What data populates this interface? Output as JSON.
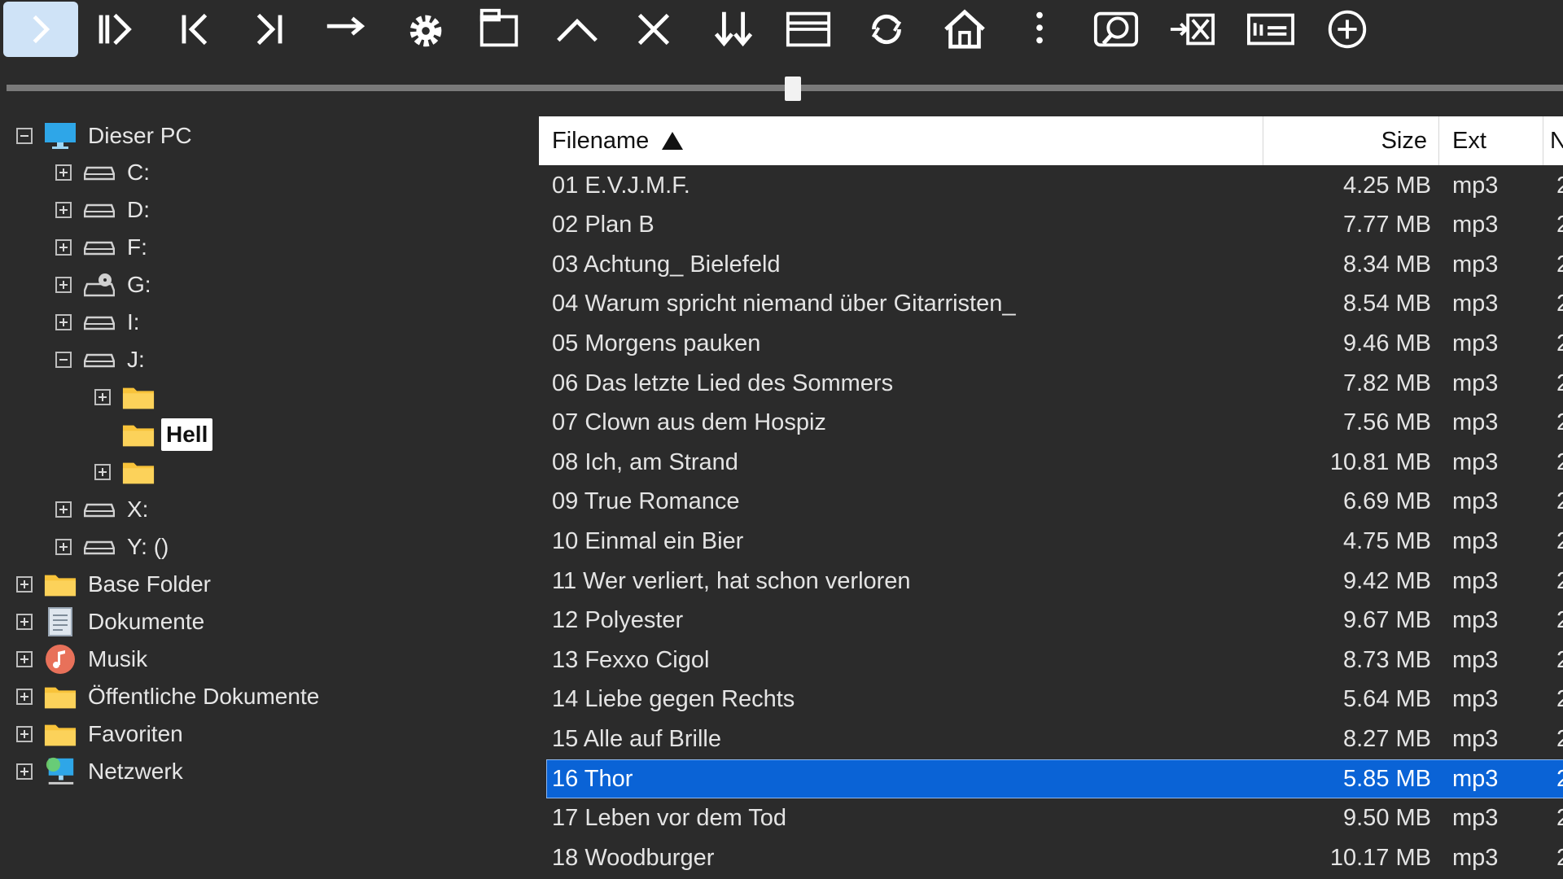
{
  "tree": {
    "root": {
      "label": "Dieser PC"
    },
    "drives": [
      {
        "label": "C:",
        "expanded": false
      },
      {
        "label": "D:",
        "expanded": false
      },
      {
        "label": "F:",
        "expanded": false
      },
      {
        "label": "G:",
        "expanded": false
      },
      {
        "label": "I:",
        "expanded": false
      },
      {
        "label": "J:",
        "expanded": true
      },
      {
        "label": "X:",
        "expanded": false
      },
      {
        "label": "Y: ()",
        "expanded": false
      }
    ],
    "j_children": [
      {
        "label": "",
        "has_children": true
      },
      {
        "label": "Hell",
        "has_children": false
      },
      {
        "label": "",
        "has_children": true
      }
    ],
    "special": [
      {
        "label": "Base Folder",
        "icon": "folder-icon"
      },
      {
        "label": "Dokumente",
        "icon": "document-icon"
      },
      {
        "label": "Musik",
        "icon": "music-icon"
      },
      {
        "label": "Öffentliche Dokumente",
        "icon": "folder-icon"
      },
      {
        "label": "Favoriten",
        "icon": "folder-icon"
      },
      {
        "label": "Netzwerk",
        "icon": "network-icon"
      }
    ]
  },
  "list": {
    "columns": {
      "name": "Filename",
      "size": "Size",
      "ext": "Ext",
      "more": "N"
    },
    "rows": [
      {
        "name": "01 E.V.J.M.F.",
        "size": "4.25 MB",
        "ext": "mp3",
        "more": "2"
      },
      {
        "name": "02 Plan B",
        "size": "7.77 MB",
        "ext": "mp3",
        "more": "2"
      },
      {
        "name": "03 Achtung_ Bielefeld",
        "size": "8.34 MB",
        "ext": "mp3",
        "more": "2"
      },
      {
        "name": "04 Warum spricht niemand über Gitarristen_",
        "size": "8.54 MB",
        "ext": "mp3",
        "more": "2"
      },
      {
        "name": "05 Morgens pauken",
        "size": "9.46 MB",
        "ext": "mp3",
        "more": "2"
      },
      {
        "name": "06 Das letzte Lied des Sommers",
        "size": "7.82 MB",
        "ext": "mp3",
        "more": "2"
      },
      {
        "name": "07 Clown aus dem Hospiz",
        "size": "7.56 MB",
        "ext": "mp3",
        "more": "2"
      },
      {
        "name": "08 Ich, am Strand",
        "size": "10.81 MB",
        "ext": "mp3",
        "more": "2"
      },
      {
        "name": "09 True Romance",
        "size": "6.69 MB",
        "ext": "mp3",
        "more": "2"
      },
      {
        "name": "10 Einmal ein Bier",
        "size": "4.75 MB",
        "ext": "mp3",
        "more": "2"
      },
      {
        "name": "11 Wer verliert, hat schon verloren",
        "size": "9.42 MB",
        "ext": "mp3",
        "more": "2"
      },
      {
        "name": "12 Polyester",
        "size": "9.67 MB",
        "ext": "mp3",
        "more": "2"
      },
      {
        "name": "13 Fexxo Cigol",
        "size": "8.73 MB",
        "ext": "mp3",
        "more": "2"
      },
      {
        "name": "14 Liebe gegen Rechts",
        "size": "5.64 MB",
        "ext": "mp3",
        "more": "2"
      },
      {
        "name": "15 Alle auf Brille",
        "size": "8.27 MB",
        "ext": "mp3",
        "more": "2"
      },
      {
        "name": "16 Thor",
        "size": "5.85 MB",
        "ext": "mp3",
        "more": "2",
        "selected": true
      },
      {
        "name": "17 Leben vor dem Tod",
        "size": "9.50 MB",
        "ext": "mp3",
        "more": "2"
      },
      {
        "name": "18 Woodburger",
        "size": "10.17 MB",
        "ext": "mp3",
        "more": "2"
      }
    ]
  },
  "toolbar": {
    "icons": [
      "play-next-icon",
      "play-pause-icon",
      "skip-back-icon",
      "skip-forward-icon",
      "arrow-right-icon",
      "gear-icon",
      "window-icon",
      "chevron-up-icon",
      "close-icon",
      "sort-down-icon",
      "split-view-icon",
      "refresh-icon",
      "home-icon",
      "more-vertical-icon",
      "search-zoom-icon",
      "move-delete-icon",
      "info-panel-icon",
      "add-circle-icon"
    ]
  },
  "slider": {
    "value": 0.505
  },
  "colors": {
    "background": "#2b2b2b",
    "selection": "#0a63d6",
    "folder": "#f8c33a",
    "drive": "#d0d0d0"
  }
}
